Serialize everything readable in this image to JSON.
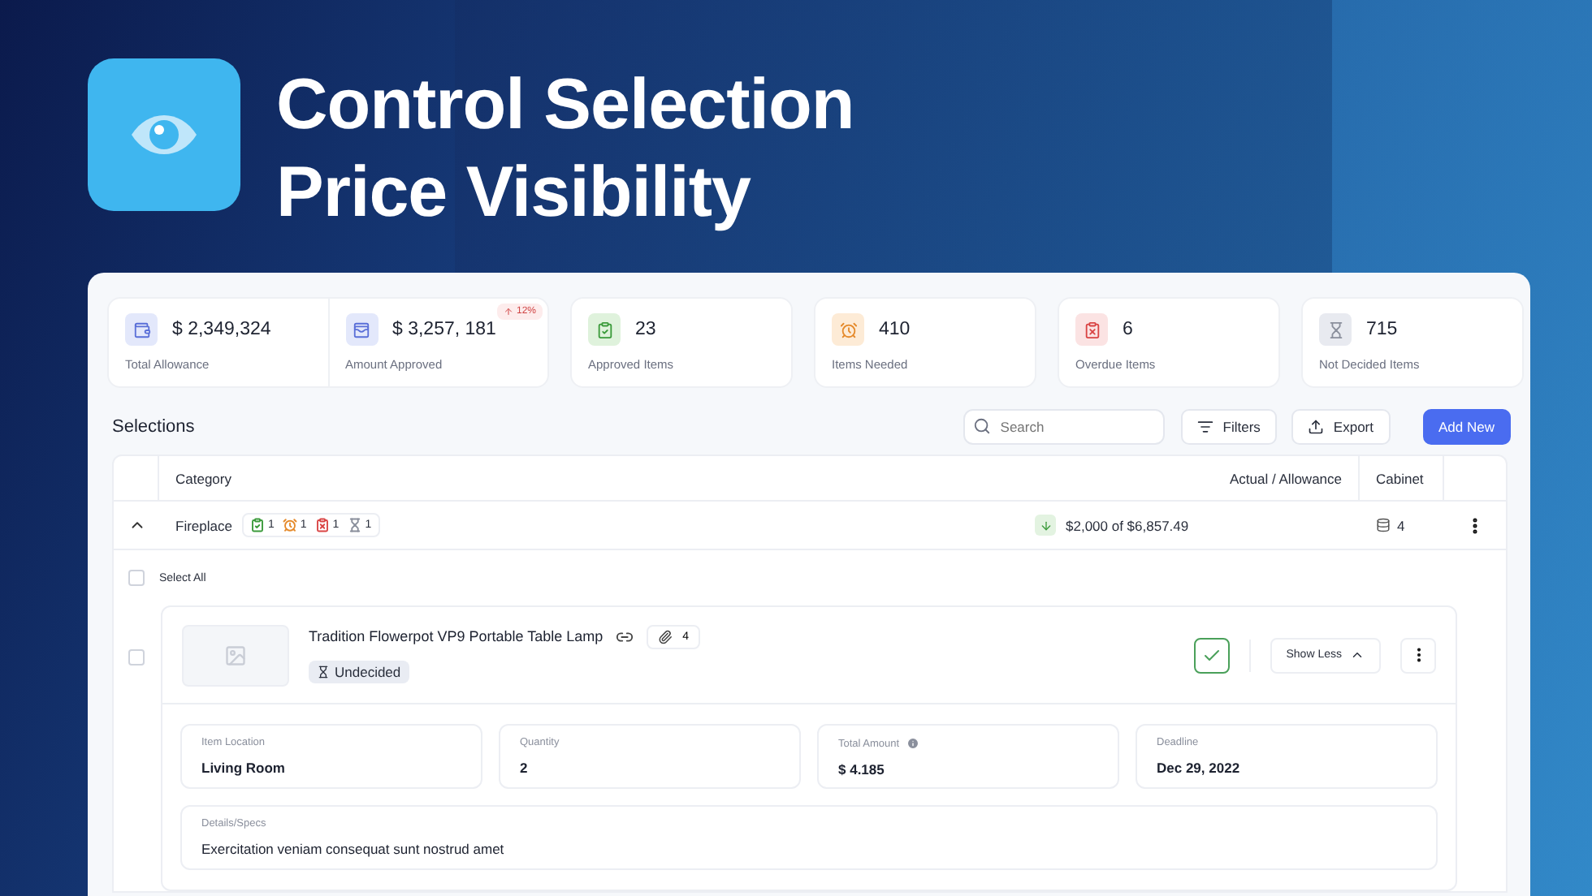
{
  "hero": {
    "title_lines": [
      "Control Selection",
      "Price Visibility"
    ]
  },
  "stats": [
    {
      "value": "$ 2,349,324",
      "label": "Total Allowance",
      "color": "#e3e8fb"
    },
    {
      "value": "$ 3,257, 181",
      "label": "Amount Approved",
      "color": "#e3e8fb",
      "badge": "12%"
    },
    {
      "value": "23",
      "label": "Approved Items",
      "color": "#dff2dc"
    },
    {
      "value": "410",
      "label": "Items Needed",
      "color": "#fdebd6"
    },
    {
      "value": "6",
      "label": "Overdue Items",
      "color": "#fbe3e3"
    },
    {
      "value": "715",
      "label": "Not Decided Items",
      "color": "#e8eaf0"
    }
  ],
  "toolbar": {
    "title": "Selections",
    "search": {
      "placeholder": "Search"
    },
    "buttons": [
      "Filters",
      "Export"
    ],
    "primary": "Add New"
  },
  "table": {
    "columns": [
      "Category",
      "Actual / Allowance",
      "Cabinet"
    ],
    "rows": [
      {
        "expanded": true,
        "name": "Fireplace",
        "counts": [
          {
            "count": "1",
            "color": "#3a9a3a"
          },
          {
            "count": "1",
            "color": "#e58a2b"
          },
          {
            "count": "1",
            "color": "#d94444"
          },
          {
            "count": "1",
            "color": "#8a8f9c"
          }
        ],
        "amount": "$2,000 of $6,857.49",
        "cabinet": "4"
      }
    ]
  },
  "select_all": {
    "label": "Select All",
    "checked": false
  },
  "item": {
    "checked": false,
    "title": "Tradition Flowerpot VP9 Portable Table Lamp",
    "attachments": "4",
    "status": "Undecided",
    "approved": true,
    "toggle": "Show Less",
    "fields": [
      {
        "label": "Item Location",
        "value": "Living Room",
        "info": false
      },
      {
        "label": "Quantity",
        "value": "2",
        "info": false
      },
      {
        "label": "Total Amount",
        "value": "$ 4.185",
        "info": true
      },
      {
        "label": "Deadline",
        "value": "Dec 29, 2022",
        "info": false
      }
    ],
    "details": {
      "label": "Details/Specs",
      "value": "Exercitation veniam consequat sunt nostrud amet"
    }
  }
}
